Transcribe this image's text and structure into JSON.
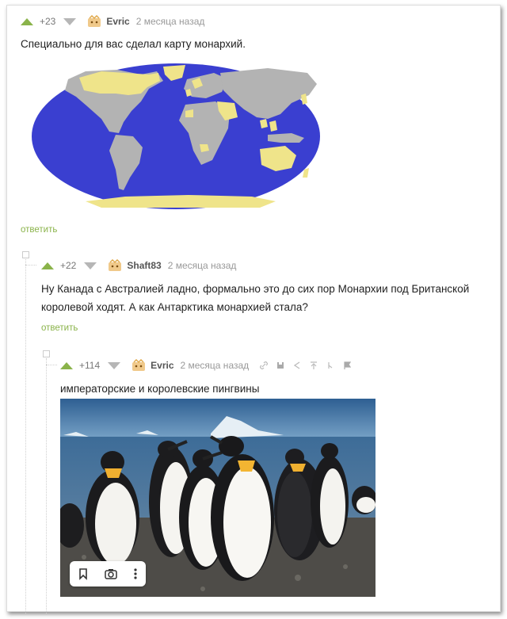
{
  "comments": [
    {
      "score": "+23",
      "nick": "Evric",
      "time": "2 месяца назад",
      "text": "Специально для вас сделал карту монархий.",
      "reply": "ответить"
    },
    {
      "score": "+22",
      "nick": "Shaft83",
      "time": "2 месяца назад",
      "text_line1": "Ну Канада с Австралией ладно, формально это до сих пор Монархии под Британской",
      "text_line2": "королевой ходят. А как Антарктика монархией стала?",
      "reply": "ответить"
    },
    {
      "score": "+114",
      "nick": "Evric",
      "time": "2 месяца назад",
      "text": "императорские и королевские пингвины",
      "tool_icons": [
        "link-icon",
        "save-icon",
        "share-icon",
        "pin-top-icon",
        "branch-icon",
        "flag-icon"
      ]
    }
  ],
  "colors": {
    "accent": "#8ab34a",
    "ocean": "#3a3fd0",
    "land": "#b3b3b3",
    "monarchy": "#efe48a"
  },
  "image_controls": [
    "bookmark-icon",
    "camera-search-icon",
    "more-icon"
  ]
}
